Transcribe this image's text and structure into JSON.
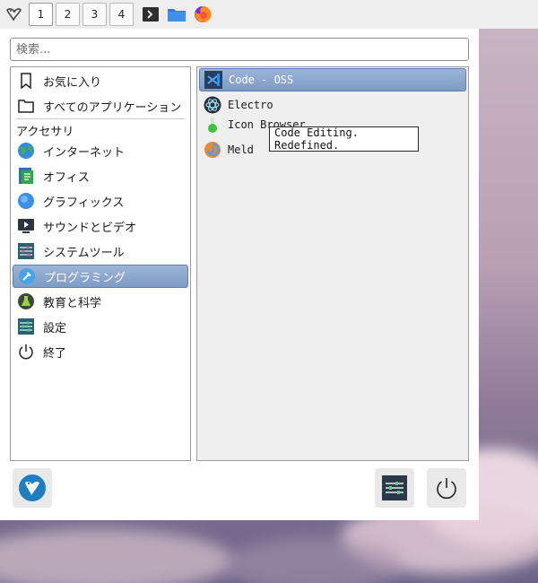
{
  "panel": {
    "workspaces": [
      "1",
      "2",
      "3",
      "4"
    ],
    "launchers": [
      "terminal-icon",
      "folder-icon",
      "firefox-icon"
    ]
  },
  "search": {
    "placeholder": "検索..."
  },
  "categories": {
    "favorites": "お気に入り",
    "all_apps": "すべてのアプリケーション",
    "section_label": "アクセサリ",
    "items": [
      {
        "label": "インターネット",
        "icon": "globe-icon"
      },
      {
        "label": "オフィス",
        "icon": "office-icon"
      },
      {
        "label": "グラフィックス",
        "icon": "graphics-icon"
      },
      {
        "label": "サウンドとビデオ",
        "icon": "multimedia-icon"
      },
      {
        "label": "システムツール",
        "icon": "system-tools-icon"
      },
      {
        "label": "プログラミング",
        "icon": "programming-icon",
        "selected": true
      },
      {
        "label": "教育と科学",
        "icon": "science-icon"
      },
      {
        "label": "設定",
        "icon": "settings-icon"
      },
      {
        "label": "終了",
        "icon": "power-icon"
      }
    ]
  },
  "apps": [
    {
      "label": "Code - OSS",
      "icon": "vscode-icon",
      "selected": true
    },
    {
      "label": "Electro",
      "icon": "electron-icon"
    },
    {
      "label": "Icon Browser",
      "icon": "icon-browser-icon"
    },
    {
      "label": "Meld",
      "icon": "meld-icon"
    }
  ],
  "tooltip": {
    "text": "Code Editing. Redefined."
  },
  "colors": {
    "selection": "#8ba6ce",
    "panel": "#eeeeee"
  }
}
